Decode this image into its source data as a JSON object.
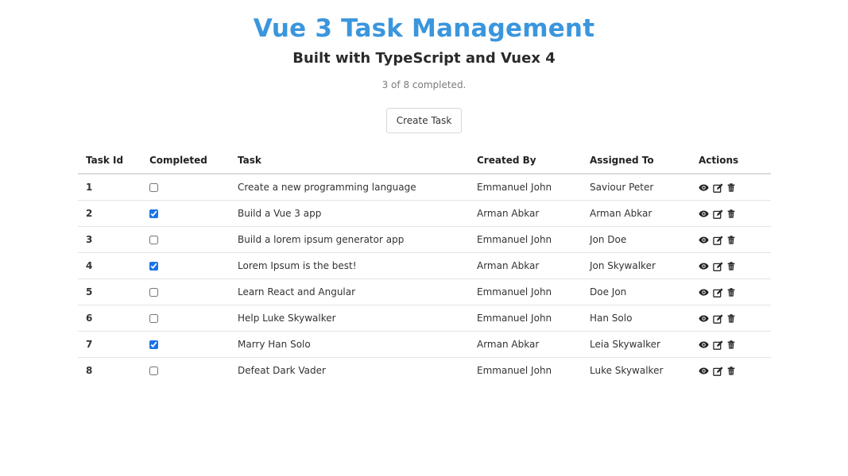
{
  "header": {
    "title": "Vue 3 Task Management",
    "subtitle": "Built with TypeScript and Vuex 4",
    "status": "3 of 8 completed."
  },
  "toolbar": {
    "create_label": "Create Task"
  },
  "table": {
    "columns": {
      "id": "Task Id",
      "completed": "Completed",
      "task": "Task",
      "created_by": "Created By",
      "assigned_to": "Assigned To",
      "actions": "Actions"
    },
    "rows": [
      {
        "id": "1",
        "completed": false,
        "task": "Create a new programming language",
        "created_by": "Emmanuel John",
        "assigned_to": "Saviour Peter"
      },
      {
        "id": "2",
        "completed": true,
        "task": "Build a Vue 3 app",
        "created_by": "Arman Abkar",
        "assigned_to": "Arman Abkar"
      },
      {
        "id": "3",
        "completed": false,
        "task": "Build a lorem ipsum generator app",
        "created_by": "Emmanuel John",
        "assigned_to": "Jon Doe"
      },
      {
        "id": "4",
        "completed": true,
        "task": "Lorem Ipsum is the best!",
        "created_by": "Arman Abkar",
        "assigned_to": "Jon Skywalker"
      },
      {
        "id": "5",
        "completed": false,
        "task": "Learn React and Angular",
        "created_by": "Emmanuel John",
        "assigned_to": "Doe Jon"
      },
      {
        "id": "6",
        "completed": false,
        "task": "Help Luke Skywalker",
        "created_by": "Emmanuel John",
        "assigned_to": "Han Solo"
      },
      {
        "id": "7",
        "completed": true,
        "task": "Marry Han Solo",
        "created_by": "Arman Abkar",
        "assigned_to": "Leia Skywalker"
      },
      {
        "id": "8",
        "completed": false,
        "task": "Defeat Dark Vader",
        "created_by": "Emmanuel John",
        "assigned_to": "Luke Skywalker"
      }
    ],
    "action_icons": [
      "eye-icon",
      "edit-icon",
      "trash-icon"
    ]
  },
  "colors": {
    "title": "#3a96dd",
    "checkbox_accent": "#1a73e8"
  }
}
